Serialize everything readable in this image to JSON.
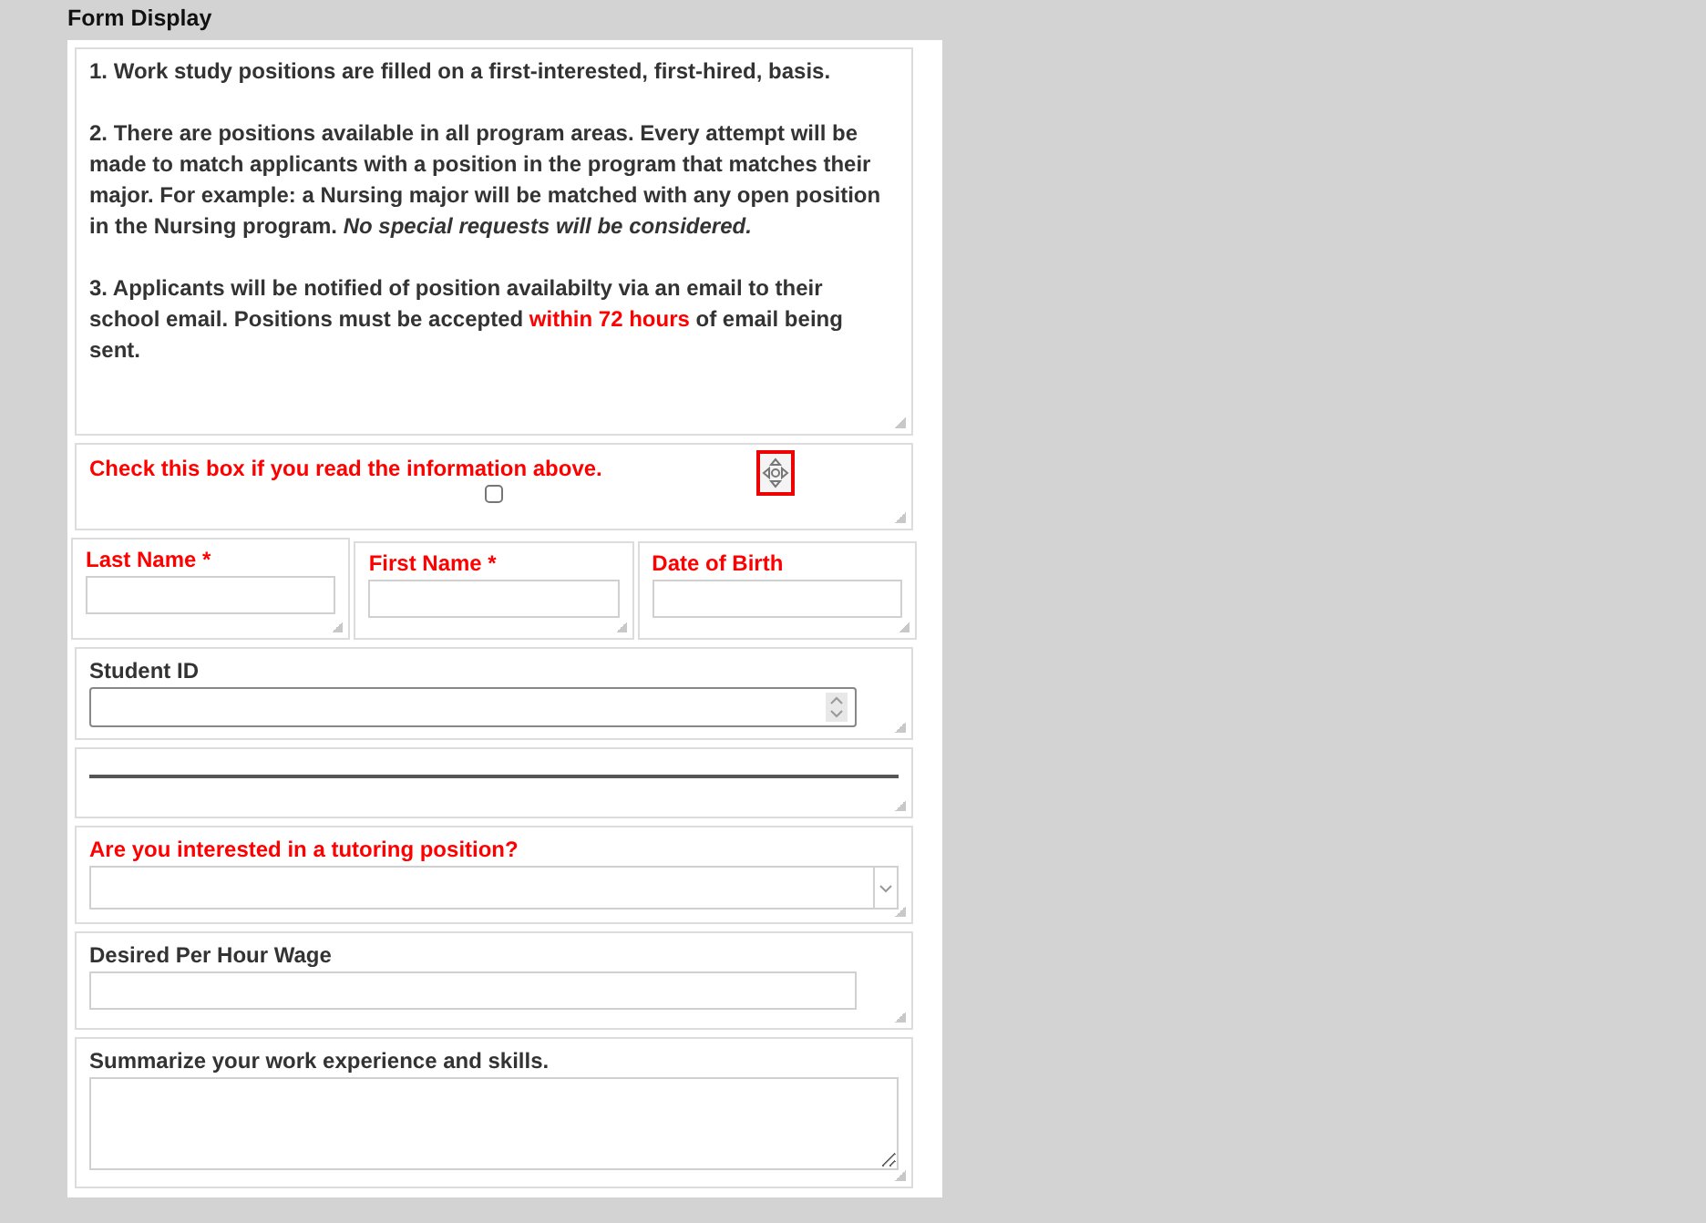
{
  "panel": {
    "title": "Form Display"
  },
  "instructions": [
    {
      "segments": [
        {
          "kind": "plain",
          "text": "1. Work study positions are filled on a first-interested, first-hired, basis."
        }
      ]
    },
    {
      "segments": [
        {
          "kind": "plain",
          "text": "2. There are positions available in all program areas. Every attempt will be made to match applicants with a position in the program that matches their major. For example: a Nursing major will be matched with any open position in the Nursing program. "
        },
        {
          "kind": "italic",
          "text": "No special requests will be considered."
        }
      ]
    },
    {
      "segments": [
        {
          "kind": "plain",
          "text": "3. Applicants will be notified of position availabilty via an email to their school email. Positions must be accepted "
        },
        {
          "kind": "red",
          "text": "within 72 hours"
        },
        {
          "kind": "plain",
          "text": " of email being sent."
        }
      ]
    }
  ],
  "fields": [
    {
      "kind": "checkbox",
      "label": "Check this box if you read the information above.",
      "required": true,
      "checked": false
    },
    {
      "kind": "group",
      "items": [
        {
          "label": "Last Name *",
          "required": true
        },
        {
          "label": "First Name *",
          "required": true
        },
        {
          "label": "Date of Birth",
          "required": true
        }
      ]
    },
    {
      "kind": "number",
      "label": "Student ID",
      "required": false
    },
    {
      "kind": "divider"
    },
    {
      "kind": "select",
      "label": "Are you interested in a tutoring position?",
      "required": true
    },
    {
      "kind": "text",
      "label": "Desired Per Hour Wage",
      "required": false
    },
    {
      "kind": "textarea",
      "label": "Summarize your work experience and skills.",
      "required": false
    }
  ]
}
